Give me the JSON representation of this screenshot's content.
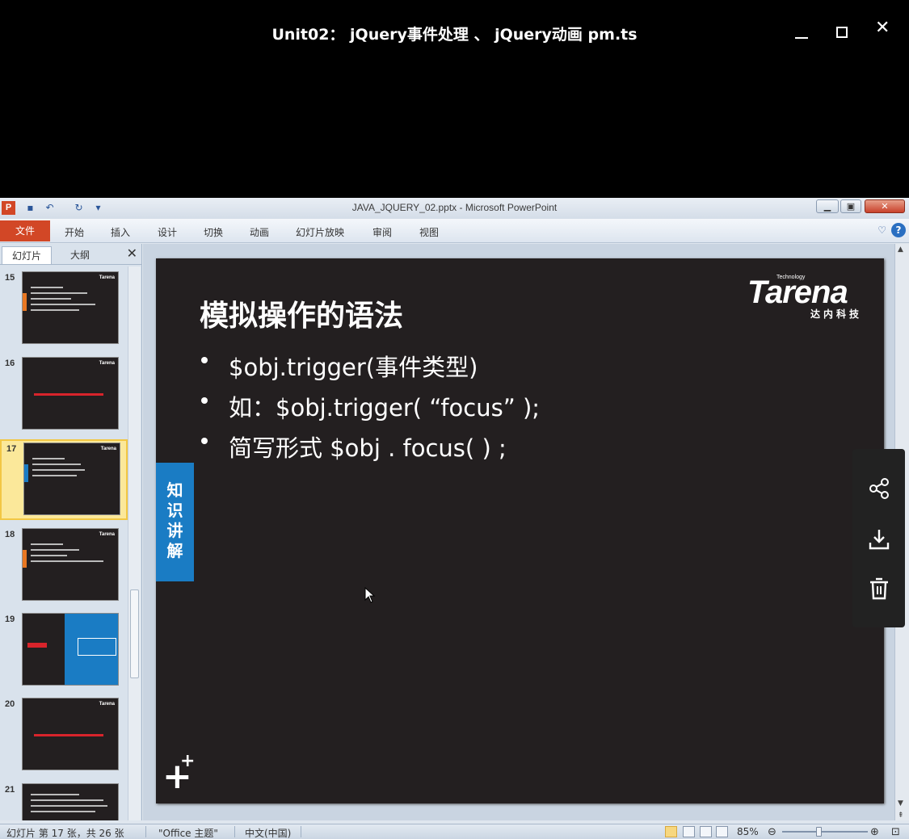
{
  "player": {
    "title": "Unit02： jQuery事件处理 、 jQuery动画 pm.ts"
  },
  "ppt": {
    "window_title": "JAVA_JQUERY_02.pptx - Microsoft PowerPoint",
    "app_icon_letter": "P",
    "ribbon_tabs": [
      "文件",
      "开始",
      "插入",
      "设计",
      "切换",
      "动画",
      "幻灯片放映",
      "审阅",
      "视图"
    ],
    "pane_tabs": [
      "幻灯片",
      "大纲"
    ],
    "thumbnails": [
      {
        "num": "15"
      },
      {
        "num": "16"
      },
      {
        "num": "17"
      },
      {
        "num": "18"
      },
      {
        "num": "19"
      },
      {
        "num": "20"
      },
      {
        "num": "21"
      }
    ],
    "slide": {
      "title": "模拟操作的语法",
      "bullets": [
        "$obj.trigger(事件类型)",
        "如：$obj.trigger( “focus” );",
        "简写形式   $obj . focus( ) ;"
      ],
      "side_label": "知识讲解",
      "brand_name": "Tarena",
      "brand_tag": "Technology",
      "brand_cn": "达内科技"
    },
    "status": {
      "slide_info": "幻灯片 第 17 张，共 26 张",
      "theme": "\"Office 主题\"",
      "language": "中文(中国)",
      "zoom": "85%"
    }
  },
  "colors": {
    "slide_bg": "#231f20",
    "accent_blue": "#1a7cc4",
    "file_tab": "#d24726"
  }
}
